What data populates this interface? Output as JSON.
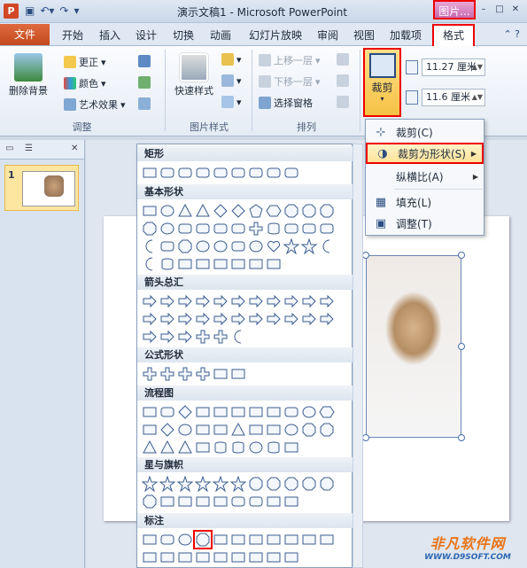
{
  "window": {
    "app_icon": "P",
    "title": "演示文稿1 - Microsoft PowerPoint",
    "contextual_tab": "图片...",
    "controls": [
      "–",
      "□",
      "✕"
    ]
  },
  "tabs": {
    "file": "文件",
    "items": [
      "开始",
      "插入",
      "设计",
      "切换",
      "动画",
      "幻灯片放映",
      "审阅",
      "视图",
      "加载项"
    ],
    "active": "格式"
  },
  "ribbon": {
    "adjust": {
      "remove_bg": "删除背景",
      "correct": "更正",
      "color": "颜色",
      "art_effects": "艺术效果",
      "label": "调整"
    },
    "picture_styles": {
      "quick_styles": "快速样式",
      "label": "图片样式"
    },
    "arrange": {
      "bring_forward": "上移一层",
      "send_backward": "下移一层",
      "selection_pane": "选择窗格",
      "label": "排列"
    },
    "size": {
      "crop": "裁剪",
      "height": "11.27 厘米",
      "width": "11.6 厘米"
    }
  },
  "crop_menu": [
    {
      "label": "裁剪(C)",
      "icon": "crop-icon",
      "submenu": false
    },
    {
      "label": "裁剪为形状(S)",
      "icon": "shape-icon",
      "submenu": true
    },
    {
      "label": "纵横比(A)",
      "icon": "",
      "submenu": true
    },
    {
      "label": "填充(L)",
      "icon": "fill-icon",
      "submenu": false
    },
    {
      "label": "调整(T)",
      "icon": "fit-icon",
      "submenu": false
    }
  ],
  "gallery": {
    "sections": [
      "矩形",
      "基本形状",
      "箭头总汇",
      "公式形状",
      "流程图",
      "星与旗帜",
      "标注"
    ]
  },
  "slides_panel": {
    "slide_number": "1"
  },
  "watermark": {
    "main": "非凡软件网",
    "url": "WWW.D9SOFT.COM"
  }
}
